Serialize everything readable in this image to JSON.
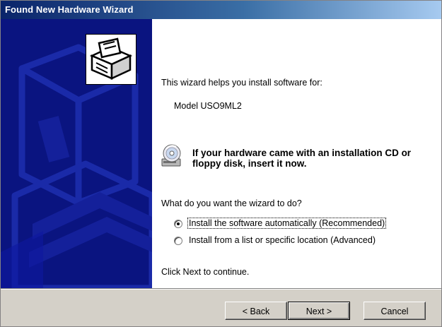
{
  "window": {
    "title": "Found New Hardware Wizard"
  },
  "content": {
    "intro": "This wizard helps you install software for:",
    "device_name": "Model USO9ML2",
    "cd_notice": "If your hardware came with an installation CD or floppy disk, insert it now.",
    "question": "What do you want the wizard to do?",
    "options": [
      {
        "label": "Install the software automatically (Recommended)",
        "selected": true
      },
      {
        "label": "Install from a list or specific location (Advanced)",
        "selected": false
      }
    ],
    "continue_text": "Click Next to continue."
  },
  "buttons": {
    "back": "< Back",
    "next": "Next >",
    "cancel": "Cancel"
  },
  "icons": {
    "wizard": "hardware-wizard-icon",
    "cd": "cd-drive-icon"
  },
  "colors": {
    "title_gradient_start": "#0a246a",
    "title_gradient_end": "#a6caf0",
    "sidebar": "#0a1480",
    "dialog_face": "#d4d0c8"
  }
}
